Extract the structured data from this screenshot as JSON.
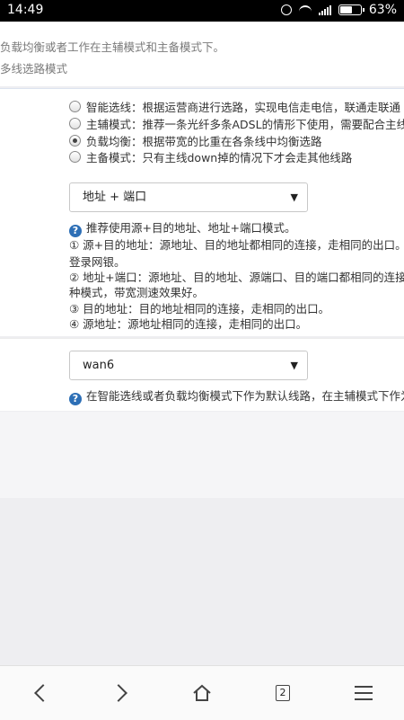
{
  "status_bar": {
    "time": "14:49",
    "battery_percent": "63%",
    "battery_level": 0.63
  },
  "description": {
    "line1": "负载均衡或者工作在主辅模式和主备模式下。",
    "line2": "多线选路模式"
  },
  "mode_options": [
    {
      "label": "智能选线：根据运营商进行选路，实现电信走电信，联通走联通",
      "checked": false
    },
    {
      "label": "主辅模式：推荐一条光纤多条ADSL的情形下使用，需要配合主线路",
      "checked": false
    },
    {
      "label": "负载均衡：根据带宽的比重在各条线中均衡选路",
      "checked": true
    },
    {
      "label": "主备模式：只有主线down掉的情况下才会走其他线路",
      "checked": false
    }
  ],
  "balance_mode": {
    "selected": "地址 + 端口",
    "help_lines": [
      "推荐使用源+目的地址、地址+端口模式。",
      "① 源+目的地址：源地址、目的地址都相同的连接，走相同的出口。网",
      "登录网银。",
      "② 地址+端口：源地址、目的地址、源端口、目的端口都相同的连接，",
      "种模式，带宽测速效果好。",
      "③ 目的地址：目的地址相同的连接，走相同的出口。",
      "④ 源地址：源地址相同的连接，走相同的出口。"
    ]
  },
  "default_line": {
    "selected": "wan6",
    "help": "在智能选线或者负载均衡模式下作为默认线路，在主辅模式下作为主线路"
  },
  "bottom_nav": {
    "tab_count": "2"
  },
  "icons": {
    "back": "chevron-left-icon",
    "forward": "chevron-right-icon",
    "home": "home-icon",
    "tabs": "tabs-icon",
    "menu": "menu-icon",
    "help": "question-circle-icon"
  },
  "colors": {
    "help_icon": "#2d6fb6",
    "page_bg": "#eeeef1"
  }
}
